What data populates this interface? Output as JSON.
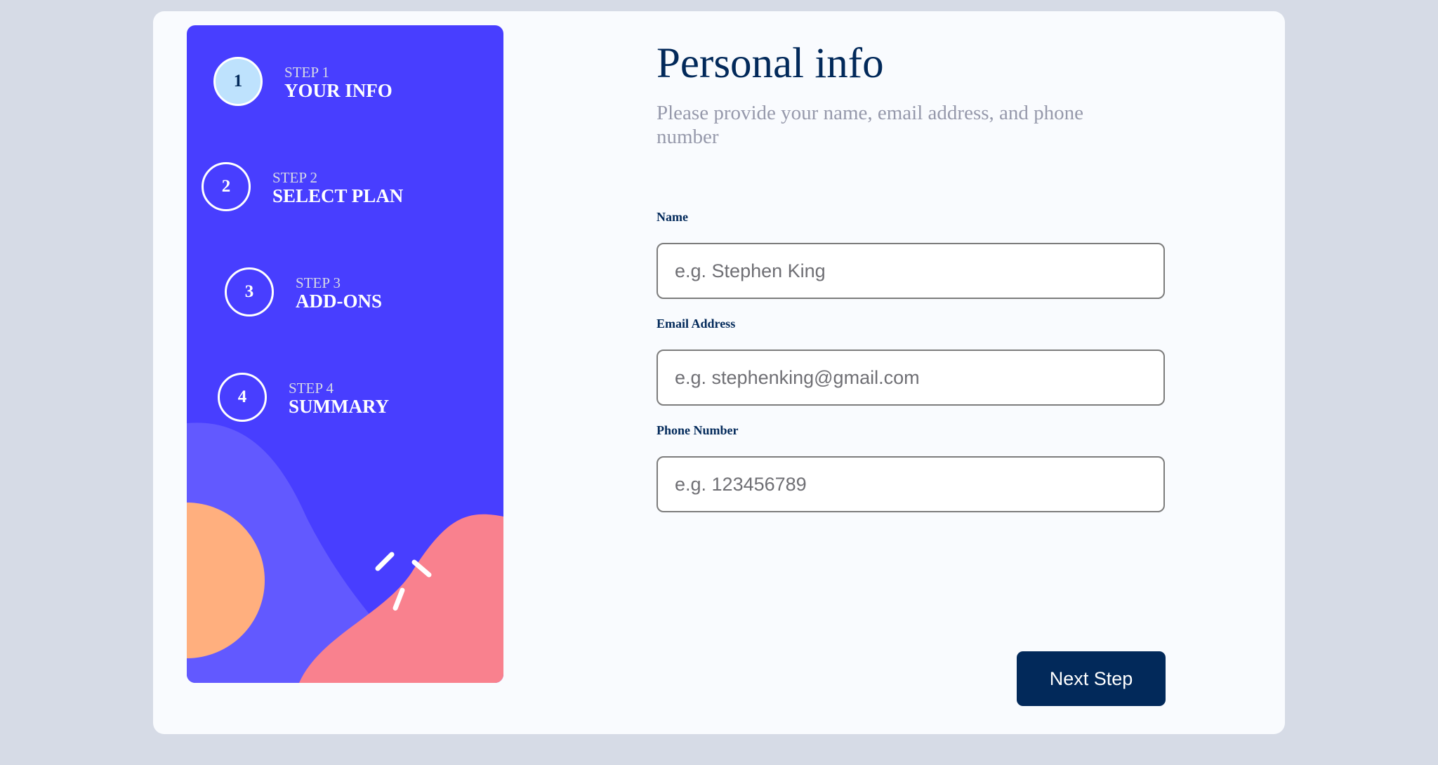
{
  "sidebar": {
    "steps": [
      {
        "number": "1",
        "label": "STEP 1",
        "title": "YOUR INFO",
        "active": true
      },
      {
        "number": "2",
        "label": "STEP 2",
        "title": "SELECT PLAN",
        "active": false
      },
      {
        "number": "3",
        "label": "STEP 3",
        "title": "ADD-ONS",
        "active": false
      },
      {
        "number": "4",
        "label": "STEP 4",
        "title": "SUMMARY",
        "active": false
      }
    ]
  },
  "main": {
    "title": "Personal info",
    "subtitle": "Please provide your name, email address, and phone number",
    "fields": {
      "name": {
        "label": "Name",
        "placeholder": "e.g. Stephen King",
        "value": ""
      },
      "email": {
        "label": "Email Address",
        "placeholder": "e.g. stephenking@gmail.com",
        "value": ""
      },
      "phone": {
        "label": "Phone Number",
        "placeholder": "e.g. 123456789",
        "value": ""
      }
    },
    "next_button": "Next Step"
  },
  "colors": {
    "page_background": "#d6dbe6",
    "card_background": "#f9fbfe",
    "sidebar_background": "#483eff",
    "active_step": "#bee2fd",
    "marine_blue": "#02295a",
    "cool_gray": "#9699ab",
    "decoration_purple": "#6259ff",
    "decoration_orange": "#ffaf7e",
    "decoration_pink": "#f9818e"
  }
}
